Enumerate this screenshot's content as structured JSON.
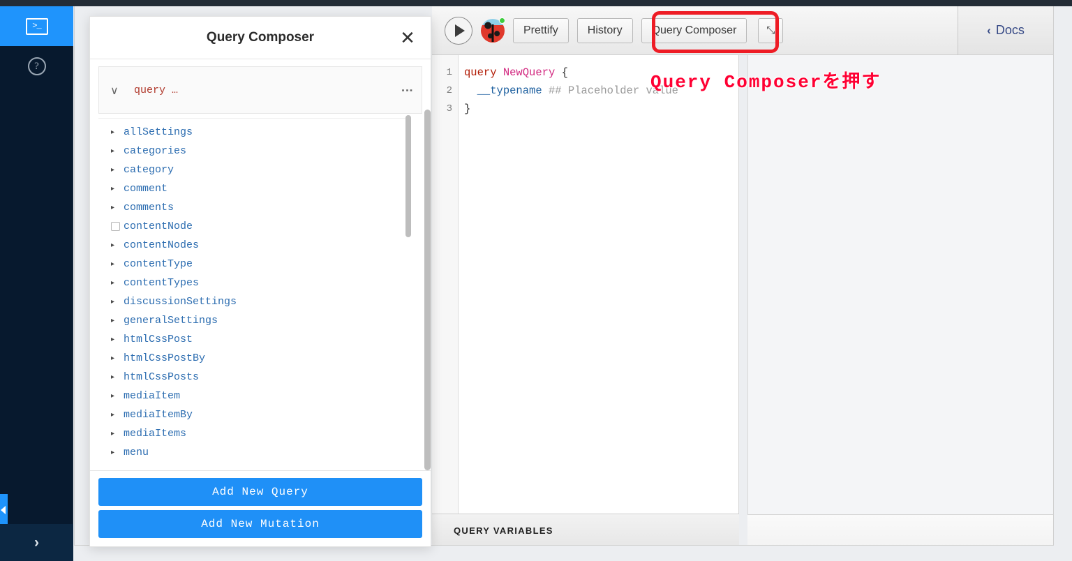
{
  "sidebar": {
    "items": [
      {
        "name": "terminal",
        "icon": "terminal-icon",
        "glyph": ">_",
        "active": true
      },
      {
        "name": "help",
        "icon": "help-circle-icon",
        "glyph": "?",
        "active": false
      }
    ],
    "expand_glyph": "›"
  },
  "toolbar": {
    "execute_label": "",
    "prettify_label": "Prettify",
    "history_label": "History",
    "query_composer_label": "Query Composer",
    "expand_icon": "expand-icon",
    "expand_glyph": "⤡",
    "avatar_icon": "ladybug-avatar",
    "docs_label": "Docs",
    "docs_chevron": "‹"
  },
  "editor": {
    "lines": [
      "1",
      "2",
      "3"
    ],
    "code": {
      "l1_kw": "query",
      "l1_name": "NewQuery",
      "l1_brace": "{",
      "l2_field": "__typename",
      "l2_comment": "## Placeholder value",
      "l3_brace": "}"
    }
  },
  "variables": {
    "title": "QUERY VARIABLES"
  },
  "modal": {
    "title": "Query Composer",
    "close_glyph": "✕",
    "operation": {
      "chevron": "∨",
      "label": "query …",
      "kebab": "⋮"
    },
    "fields": [
      {
        "label": "allSettings",
        "control": "arrow"
      },
      {
        "label": "categories",
        "control": "arrow"
      },
      {
        "label": "category",
        "control": "arrow"
      },
      {
        "label": "comment",
        "control": "arrow"
      },
      {
        "label": "comments",
        "control": "arrow"
      },
      {
        "label": "contentNode",
        "control": "checkbox"
      },
      {
        "label": "contentNodes",
        "control": "arrow"
      },
      {
        "label": "contentType",
        "control": "arrow"
      },
      {
        "label": "contentTypes",
        "control": "arrow"
      },
      {
        "label": "discussionSettings",
        "control": "arrow"
      },
      {
        "label": "generalSettings",
        "control": "arrow"
      },
      {
        "label": "htmlCssPost",
        "control": "arrow"
      },
      {
        "label": "htmlCssPostBy",
        "control": "arrow"
      },
      {
        "label": "htmlCssPosts",
        "control": "arrow"
      },
      {
        "label": "mediaItem",
        "control": "arrow"
      },
      {
        "label": "mediaItemBy",
        "control": "arrow"
      },
      {
        "label": "mediaItems",
        "control": "arrow"
      },
      {
        "label": "menu",
        "control": "arrow"
      }
    ],
    "add_query_label": "Add New Query",
    "add_mutation_label": "Add New Mutation"
  },
  "annotation": {
    "text": "Query Composerを押す",
    "color": "#ff0033"
  },
  "colors": {
    "accent_blue": "#1f90f7",
    "sidebar_bg": "#07192e",
    "annotation_red": "#ff0033",
    "field_blue": "#2b6cb0",
    "keyword_red": "#b11a04"
  }
}
